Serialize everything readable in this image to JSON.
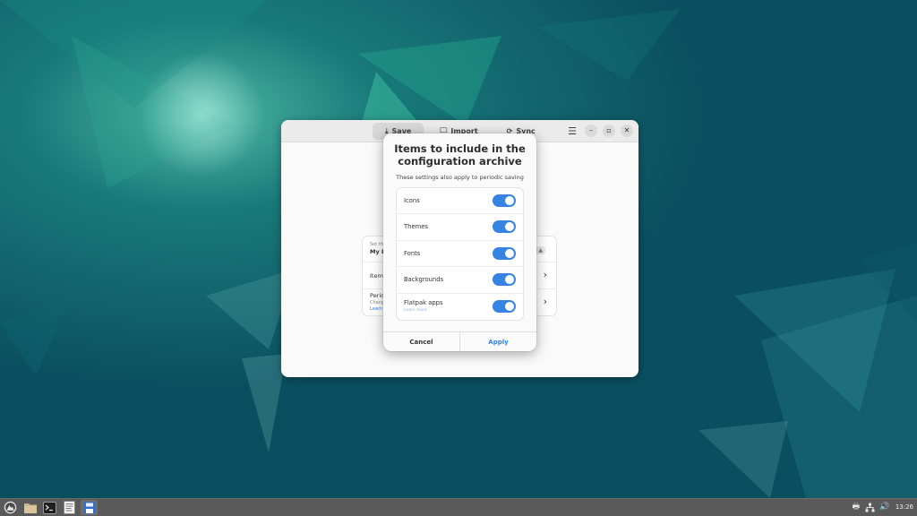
{
  "app_window": {
    "tabs": [
      {
        "label": "Save",
        "icon": "download-icon",
        "active": true
      },
      {
        "label": "Import",
        "icon": "import-icon",
        "active": false
      },
      {
        "label": "Sync",
        "icon": "sync-icon",
        "active": false
      }
    ],
    "background_rows": {
      "row1_small": "Set th",
      "row1_title": "My D",
      "row2_title": "Item",
      "row3_title": "Perio",
      "row3_sub": "Chang",
      "row3_link": "Learn"
    }
  },
  "dialog": {
    "title": "Items to include in the configuration archive",
    "subtitle": "These settings also apply to periodic saving",
    "items": [
      {
        "label": "Icons",
        "enabled": true
      },
      {
        "label": "Themes",
        "enabled": true
      },
      {
        "label": "Fonts",
        "enabled": true
      },
      {
        "label": "Backgrounds",
        "enabled": true
      },
      {
        "label": "Flatpak apps",
        "sub": "Learn more",
        "enabled": true
      }
    ],
    "cancel_label": "Cancel",
    "apply_label": "Apply",
    "accent_color": "#3584e4"
  },
  "taskbar": {
    "launchers": [
      "app-menu-icon",
      "file-manager-icon",
      "terminal-icon",
      "text-editor-icon",
      "save-desktop-icon"
    ],
    "tray": [
      "printer-icon",
      "network-icon",
      "volume-icon"
    ],
    "clock": "13:26"
  }
}
